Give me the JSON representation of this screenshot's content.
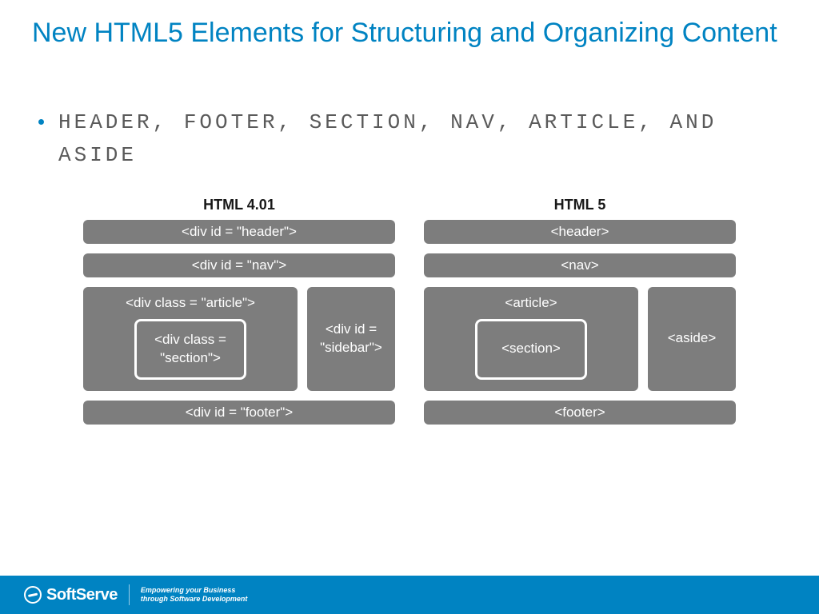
{
  "title": "New HTML5 Elements for Structuring and Organizing Content",
  "bullet": "Header, Footer, Section, Nav, Article, and aside",
  "chart_data": {
    "type": "table",
    "title": "HTML 4.01 vs HTML 5 structural elements",
    "columns": [
      "HTML 4.01",
      "HTML 5"
    ],
    "rows": [
      [
        "<div id = \"header\">",
        "<header>"
      ],
      [
        "<div id = \"nav\">",
        "<nav>"
      ],
      [
        "<div class = \"article\"> containing <div class = \"section\">",
        "<article> containing <section>"
      ],
      [
        "<div id = \"sidebar\">",
        "<aside>"
      ],
      [
        "<div id = \"footer\">",
        "<footer>"
      ]
    ]
  },
  "cols": {
    "left": {
      "title": "HTML 4.01",
      "header": "<div id = \"header\">",
      "nav": "<div id = \"nav\">",
      "article": "<div class = \"article\">",
      "section": "<div class = \"section\">",
      "sidebar": "<div id = \"sidebar\">",
      "footer": "<div id = \"footer\">"
    },
    "right": {
      "title": "HTML 5",
      "header": "<header>",
      "nav": "<nav>",
      "article": "<article>",
      "section": "<section>",
      "sidebar": "<aside>",
      "footer": "<footer>"
    }
  },
  "footer": {
    "brand": "SoftServe",
    "tagline1": "Empowering your Business",
    "tagline2": "through Software Development"
  }
}
